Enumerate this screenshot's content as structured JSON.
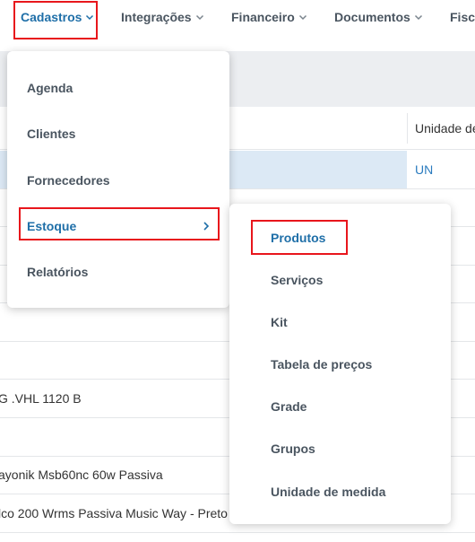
{
  "nav": {
    "items": [
      {
        "label": "Cadastros"
      },
      {
        "label": "Integrações"
      },
      {
        "label": "Financeiro"
      },
      {
        "label": "Documentos"
      },
      {
        "label": "Fisc"
      }
    ]
  },
  "table": {
    "unit_header": "Unidade de",
    "selected_unit": "UN",
    "rows": [
      "G .VHL 1120 B",
      "ayonik Msb60nc 60w Passiva",
      "lco 200 Wrms Passiva Music Way - Preto"
    ]
  },
  "menu_main": {
    "items": [
      {
        "label": "Agenda"
      },
      {
        "label": "Clientes"
      },
      {
        "label": "Fornecedores"
      },
      {
        "label": "Estoque"
      },
      {
        "label": "Relatórios"
      }
    ]
  },
  "menu_sub": {
    "items": [
      {
        "label": "Produtos"
      },
      {
        "label": "Serviços"
      },
      {
        "label": "Kit"
      },
      {
        "label": "Tabela de preços"
      },
      {
        "label": "Grade"
      },
      {
        "label": "Grupos"
      },
      {
        "label": "Unidade de medida"
      }
    ]
  },
  "colors": {
    "accent": "#1f6fa8",
    "highlight_box": "#e8161c",
    "selected_row": "#dce9f5",
    "gray_band": "#eceef1"
  }
}
